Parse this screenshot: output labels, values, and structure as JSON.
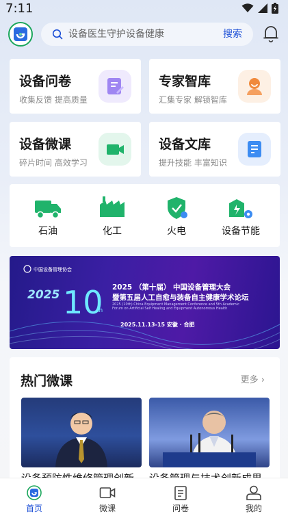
{
  "status": {
    "time": "7:11"
  },
  "search": {
    "placeholder": "设备医生守护设备健康",
    "button": "搜索"
  },
  "feature_cards": [
    {
      "title": "设备问卷",
      "subtitle": "收集反馈 提高质量",
      "icon": "questionnaire-icon"
    },
    {
      "title": "专家智库",
      "subtitle": "汇集专家 解锁智库",
      "icon": "expert-icon"
    },
    {
      "title": "设备微课",
      "subtitle": "碎片时间 高效学习",
      "icon": "video-icon"
    },
    {
      "title": "设备文库",
      "subtitle": "提升技能 丰富知识",
      "icon": "document-icon"
    }
  ],
  "industries": [
    {
      "label": "石油",
      "icon": "truck-icon"
    },
    {
      "label": "化工",
      "icon": "factory-icon"
    },
    {
      "label": "火电",
      "icon": "shield-icon"
    },
    {
      "label": "设备节能",
      "icon": "energy-gear-icon"
    }
  ],
  "banner": {
    "org": "中国设备管理协会",
    "year": "2025",
    "edition_num": "10",
    "edition_suffix": "th",
    "line1": "2025 （第十届） 中国设备管理大会",
    "line2": "暨第五届人工自愈与装备自主健康学术论坛",
    "english": "2025 (10th) China Equipment Management Conference and 5th Academic Forum on Artificial Self Healing and Equipment Autonomous Health",
    "date": "2025.11.13-15   安徽 · 合肥"
  },
  "hot": {
    "title": "热门微课",
    "more": "更多",
    "videos": [
      {
        "title": "设备预防性维修管理创新"
      },
      {
        "title": "设备管理与技术创新成果"
      }
    ]
  },
  "tabs": [
    {
      "label": "首页",
      "active": true
    },
    {
      "label": "微课",
      "active": false
    },
    {
      "label": "问卷",
      "active": false
    },
    {
      "label": "我的",
      "active": false
    }
  ],
  "colors": {
    "accent": "#1c4fd6",
    "green": "#1aa65b"
  }
}
